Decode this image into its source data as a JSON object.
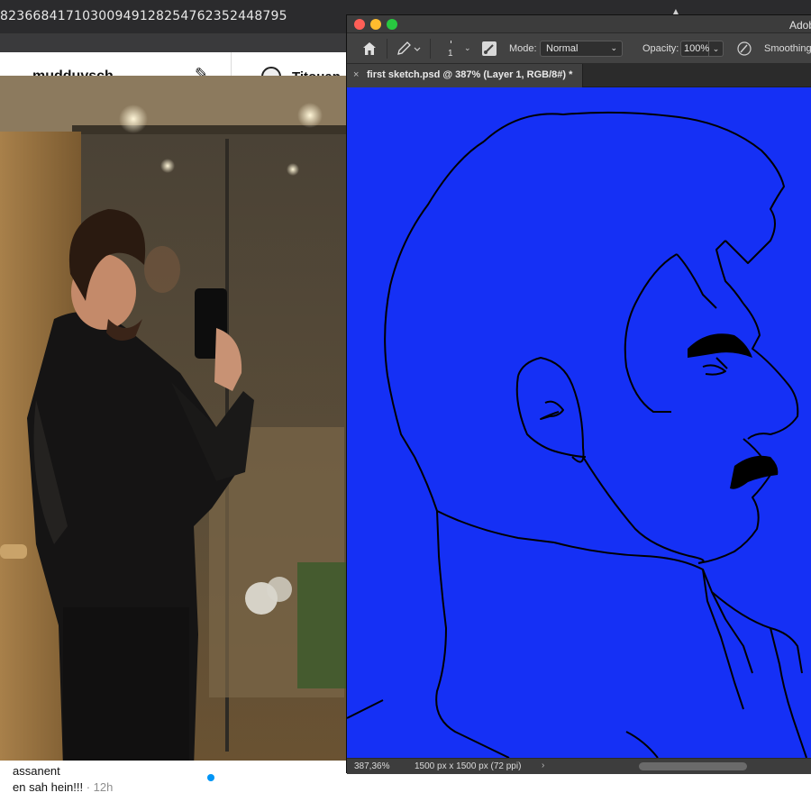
{
  "browser": {
    "url_fragment": "8236684171030094912825476235244879 5",
    "url_shown": "82366841710300949128254762352448795"
  },
  "instagram": {
    "username": "mudduvsch",
    "chat_name": "Titouan",
    "message": {
      "sender": "assanent",
      "text": "en sah hein!!!",
      "time": "· 12h"
    }
  },
  "photoshop": {
    "app_title": "Adob",
    "options": {
      "brush_size": "1",
      "mode_label": "Mode:",
      "mode_value": "Normal",
      "opacity_label": "Opacity:",
      "opacity_value": "100%",
      "smoothing_label": "Smoothing:"
    },
    "doc_tab": {
      "close": "×",
      "title": "first sketch.psd @ 387% (Layer 1, RGB/8#) *"
    },
    "status": {
      "zoom": "387,36%",
      "doc_size": "1500 px x 1500 px (72 ppi)",
      "arrow": "›"
    },
    "canvas_color": "#1530f5"
  },
  "colors": {
    "canvas_blue": "#1530f5",
    "ps_panel": "#424242",
    "ig_blue_dot": "#0095f6"
  },
  "icons": {
    "home": "home-icon",
    "pencil": "pencil-icon",
    "brush_panel": "brush-panel-icon",
    "pressure": "pressure-icon"
  }
}
